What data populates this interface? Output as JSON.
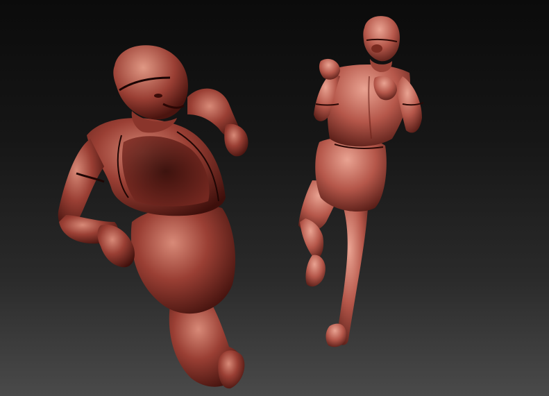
{
  "viewport": {
    "background_top": "#0b0b0b",
    "background_bottom": "#4a4a4a"
  },
  "models": [
    {
      "name": "figure-left-crouched",
      "material_color": "#9a3f34",
      "highlight_color": "#d88a78",
      "shadow_color": "#3d0f0b"
    },
    {
      "name": "figure-right-standing",
      "material_color": "#b5574a",
      "highlight_color": "#e9a392",
      "shadow_color": "#4a1510"
    }
  ]
}
